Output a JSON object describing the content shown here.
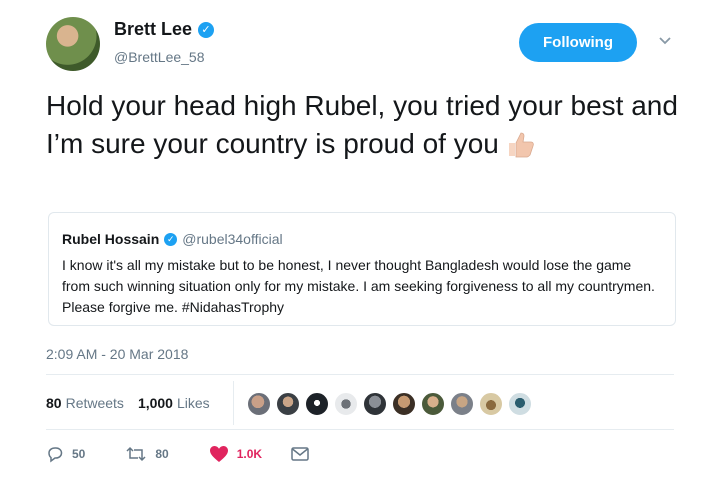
{
  "author": {
    "display_name": "Brett Lee",
    "handle": "@BrettLee_58",
    "verified": true
  },
  "follow_button": {
    "label": "Following",
    "color": "#1da1f2"
  },
  "tweet": {
    "text": "Hold your head high Rubel, you tried your best and I’m sure your country is proud of you"
  },
  "quoted_tweet": {
    "display_name": "Rubel Hossain",
    "handle": "@rubel34official",
    "text": "I know it's all my mistake but to be honest, I never thought Bangladesh would lose the game from such winning situation only for my mistake. I am seeking forgiveness to all my countrymen. Please forgive me. #NidahasTrophy"
  },
  "timestamp": "2:09 AM - 20 Mar 2018",
  "stats": {
    "retweets_count": "80",
    "retweets_label": "Retweets",
    "likes_count": "1,000",
    "likes_label": "Likes"
  },
  "actions": {
    "replies": "50",
    "retweets": "80",
    "likes": "1.0K"
  },
  "icons": {
    "reply": "reply-icon",
    "retweet": "retweet-icon",
    "like": "heart-icon",
    "dm": "envelope-icon",
    "caret": "chevron-down-icon",
    "verified": "verified-badge-icon",
    "emoji": "thumbs-up-emoji"
  },
  "colors": {
    "accent": "#1da1f2",
    "like": "#e0245e",
    "muted": "#657786"
  }
}
